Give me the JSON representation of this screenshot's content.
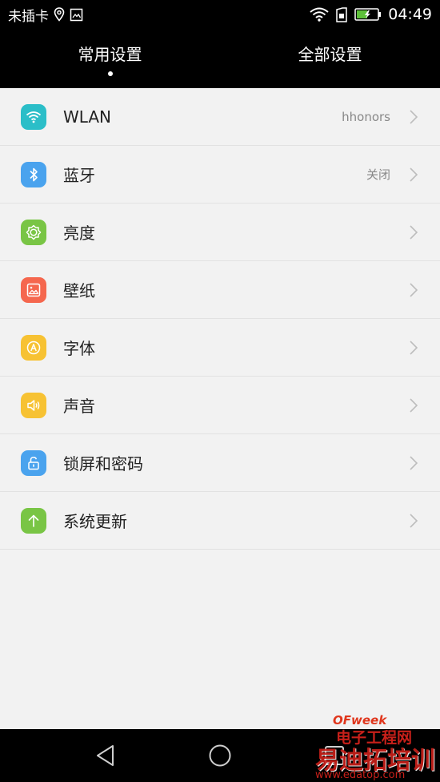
{
  "status_bar": {
    "carrier": "未插卡",
    "time": "04:49"
  },
  "tabs": [
    {
      "label": "常用设置",
      "active": true
    },
    {
      "label": "全部设置",
      "active": false
    }
  ],
  "settings": [
    {
      "icon": "wifi-icon",
      "label": "WLAN",
      "value": "hhonors",
      "color": "#2bbec8"
    },
    {
      "icon": "bluetooth-icon",
      "label": "蓝牙",
      "value": "关闭",
      "color": "#4aa3ee"
    },
    {
      "icon": "brightness-icon",
      "label": "亮度",
      "value": "",
      "color": "#79c545"
    },
    {
      "icon": "wallpaper-icon",
      "label": "壁纸",
      "value": "",
      "color": "#f5674e"
    },
    {
      "icon": "font-icon",
      "label": "字体",
      "value": "",
      "color": "#f7c233"
    },
    {
      "icon": "sound-icon",
      "label": "声音",
      "value": "",
      "color": "#f7c233"
    },
    {
      "icon": "lock-icon",
      "label": "锁屏和密码",
      "value": "",
      "color": "#4aa3ee"
    },
    {
      "icon": "update-icon",
      "label": "系统更新",
      "value": "",
      "color": "#79c545"
    }
  ],
  "nav": {
    "back": "back-icon",
    "home": "home-icon",
    "recents": "recents-icon"
  },
  "watermark": {
    "brand": "OFweek",
    "line1": "电子工程网",
    "line2": "易迪拓培训",
    "url": "www.edatop.com"
  }
}
